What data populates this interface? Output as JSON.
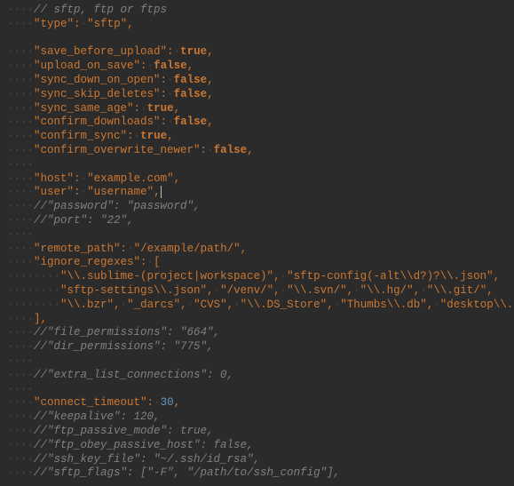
{
  "lines": [
    {
      "t": "comment",
      "indent": 4,
      "text": "// sftp, ftp or ftps"
    },
    {
      "t": "kv",
      "indent": 4,
      "key": "type",
      "v": {
        "kind": "str",
        "val": "sftp"
      },
      "comma": true
    },
    {
      "t": "blank",
      "indent": 0
    },
    {
      "t": "kv",
      "indent": 4,
      "key": "save_before_upload",
      "v": {
        "kind": "true"
      },
      "comma": true
    },
    {
      "t": "kv",
      "indent": 4,
      "key": "upload_on_save",
      "v": {
        "kind": "false"
      },
      "comma": true
    },
    {
      "t": "kv",
      "indent": 4,
      "key": "sync_down_on_open",
      "v": {
        "kind": "false"
      },
      "comma": true
    },
    {
      "t": "kv",
      "indent": 4,
      "key": "sync_skip_deletes",
      "v": {
        "kind": "false"
      },
      "comma": true
    },
    {
      "t": "kv",
      "indent": 4,
      "key": "sync_same_age",
      "v": {
        "kind": "true"
      },
      "comma": true
    },
    {
      "t": "kv",
      "indent": 4,
      "key": "confirm_downloads",
      "v": {
        "kind": "false"
      },
      "comma": true
    },
    {
      "t": "kv",
      "indent": 4,
      "key": "confirm_sync",
      "v": {
        "kind": "true"
      },
      "comma": true
    },
    {
      "t": "kv",
      "indent": 4,
      "key": "confirm_overwrite_newer",
      "v": {
        "kind": "false"
      },
      "comma": true
    },
    {
      "t": "blank",
      "indent": 4
    },
    {
      "t": "kv",
      "indent": 4,
      "key": "host",
      "v": {
        "kind": "str",
        "val": "example.com"
      },
      "comma": true
    },
    {
      "t": "kv",
      "indent": 4,
      "key": "user",
      "v": {
        "kind": "str",
        "val": "username"
      },
      "comma": true,
      "cursor": true
    },
    {
      "t": "comment",
      "indent": 4,
      "text": "//\"password\": \"password\","
    },
    {
      "t": "comment",
      "indent": 4,
      "text": "//\"port\": \"22\","
    },
    {
      "t": "blank",
      "indent": 4
    },
    {
      "t": "kv",
      "indent": 4,
      "key": "remote_path",
      "v": {
        "kind": "str",
        "val": "/example/path/"
      },
      "comma": true
    },
    {
      "t": "karr",
      "indent": 4,
      "key": "ignore_regexes"
    },
    {
      "t": "arr",
      "indent": 8,
      "items": [
        "\\\\.sublime-(project|workspace)",
        "sftp-config(-alt\\\\d?)?\\\\.json"
      ],
      "comma": true
    },
    {
      "t": "arr",
      "indent": 8,
      "items": [
        "sftp-settings\\\\.json",
        "/venv/",
        "\\\\.svn/",
        "\\\\.hg/",
        "\\\\.git/"
      ],
      "comma": true
    },
    {
      "t": "arr",
      "indent": 8,
      "items": [
        "\\\\.bzr",
        "_darcs",
        "CVS",
        "\\\\.DS_Store",
        "Thumbs\\\\.db",
        "desktop\\\\.ini"
      ],
      "comma": false
    },
    {
      "t": "close",
      "indent": 4,
      "text": "],"
    },
    {
      "t": "comment",
      "indent": 4,
      "text": "//\"file_permissions\": \"664\","
    },
    {
      "t": "comment",
      "indent": 4,
      "text": "//\"dir_permissions\": \"775\","
    },
    {
      "t": "blank",
      "indent": 4
    },
    {
      "t": "comment",
      "indent": 4,
      "text": "//\"extra_list_connections\": 0,"
    },
    {
      "t": "blank",
      "indent": 4
    },
    {
      "t": "kv",
      "indent": 4,
      "key": "connect_timeout",
      "v": {
        "kind": "num",
        "val": "30"
      },
      "comma": true
    },
    {
      "t": "comment",
      "indent": 4,
      "text": "//\"keepalive\": 120,"
    },
    {
      "t": "comment",
      "indent": 4,
      "text": "//\"ftp_passive_mode\": true,"
    },
    {
      "t": "comment",
      "indent": 4,
      "text": "//\"ftp_obey_passive_host\": false,"
    },
    {
      "t": "comment",
      "indent": 4,
      "text": "//\"ssh_key_file\": \"~/.ssh/id_rsa\","
    },
    {
      "t": "comment",
      "indent": 4,
      "text": "//\"sftp_flags\": [\"-F\", \"/path/to/ssh_config\"],"
    }
  ]
}
